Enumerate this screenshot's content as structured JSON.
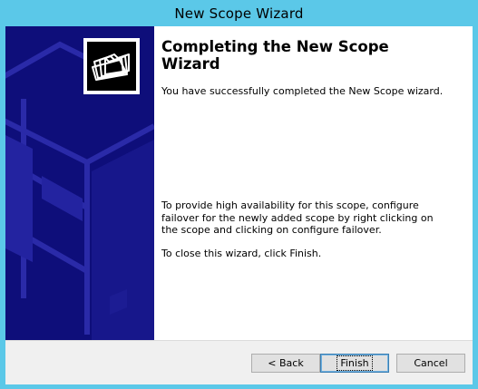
{
  "window": {
    "title": "New Scope Wizard"
  },
  "content": {
    "heading": "Completing the New Scope Wizard",
    "success_text": "You have successfully completed the New Scope wizard.",
    "failover_text": "To provide high availability for this scope, configure failover for the newly added scope by right clicking on the scope and clicking on configure failover.",
    "close_text": "To close this wizard, click Finish."
  },
  "buttons": {
    "back_label": "< Back",
    "finish_label": "Finish",
    "cancel_label": "Cancel"
  },
  "icons": {
    "wizard_icon": "folders-icon"
  },
  "colors": {
    "title_bar": "#5bc8e8",
    "banner": "#0e0e7a",
    "client_bg": "#ffffff",
    "footer_bg": "#f0f0f0"
  }
}
